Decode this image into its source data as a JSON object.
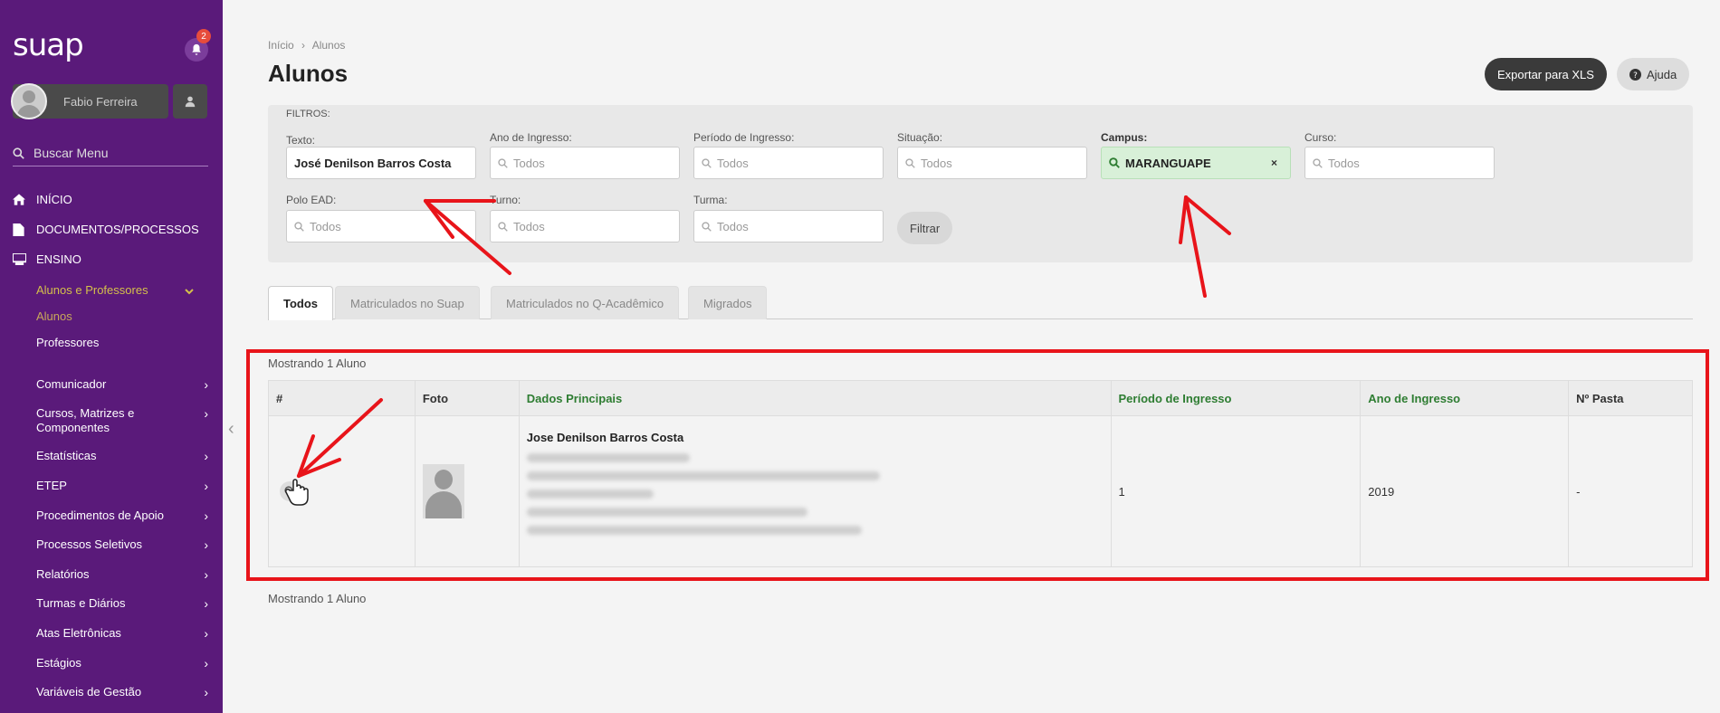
{
  "sidebar": {
    "logo": "suap",
    "notifications_count": "2",
    "user_name": "Fabio Ferreira",
    "search_placeholder": "Buscar Menu",
    "top_items": [
      {
        "label": "INÍCIO",
        "icon": "home-icon"
      },
      {
        "label": "DOCUMENTOS/PROCESSOS",
        "icon": "document-icon"
      },
      {
        "label": "ENSINO",
        "icon": "teaching-icon"
      }
    ],
    "ensino_sub": {
      "group": "Alunos e Professores",
      "items": [
        "Alunos",
        "Professores"
      ]
    },
    "menu_items": [
      "Comunicador",
      "Cursos, Matrizes e Componentes",
      "Estatísticas",
      "ETEP",
      "Procedimentos de Apoio",
      "Processos Seletivos",
      "Relatórios",
      "Turmas e Diários",
      "Atas Eletrônicas",
      "Estágios",
      "Variáveis de Gestão"
    ]
  },
  "header": {
    "breadcrumb_home": "Início",
    "breadcrumb_sep": "›",
    "breadcrumb_current": "Alunos",
    "title": "Alunos",
    "export_label": "Exportar para XLS",
    "help_label": "Ajuda"
  },
  "filters": {
    "title": "FILTROS:",
    "texto_label": "Texto:",
    "texto_value": "José Denilson Barros Costa",
    "ano_label": "Ano de Ingresso:",
    "periodo_label": "Período de Ingresso:",
    "situacao_label": "Situação:",
    "campus_label": "Campus:",
    "campus_value": "MARANGUAPE",
    "curso_label": "Curso:",
    "polo_label": "Polo EAD:",
    "turno_label": "Turno:",
    "turma_label": "Turma:",
    "todos": "Todos",
    "filter_button": "Filtrar"
  },
  "tabs": [
    "Todos",
    "Matriculados no Suap",
    "Matriculados no Q-Acadêmico",
    "Migrados"
  ],
  "results": {
    "count_text": "Mostrando 1 Aluno",
    "columns": [
      "#",
      "Foto",
      "Dados Principais",
      "Período de Ingresso",
      "Ano de Ingresso",
      "Nº Pasta"
    ],
    "rows": [
      {
        "name": "Jose Denilson Barros Costa",
        "periodo": "1",
        "ano": "2019",
        "pasta": "-"
      }
    ]
  },
  "colors": {
    "sidebar_bg": "#5a1a7a",
    "accent_green": "#2e7d32",
    "annotation_red": "#e8141a"
  }
}
